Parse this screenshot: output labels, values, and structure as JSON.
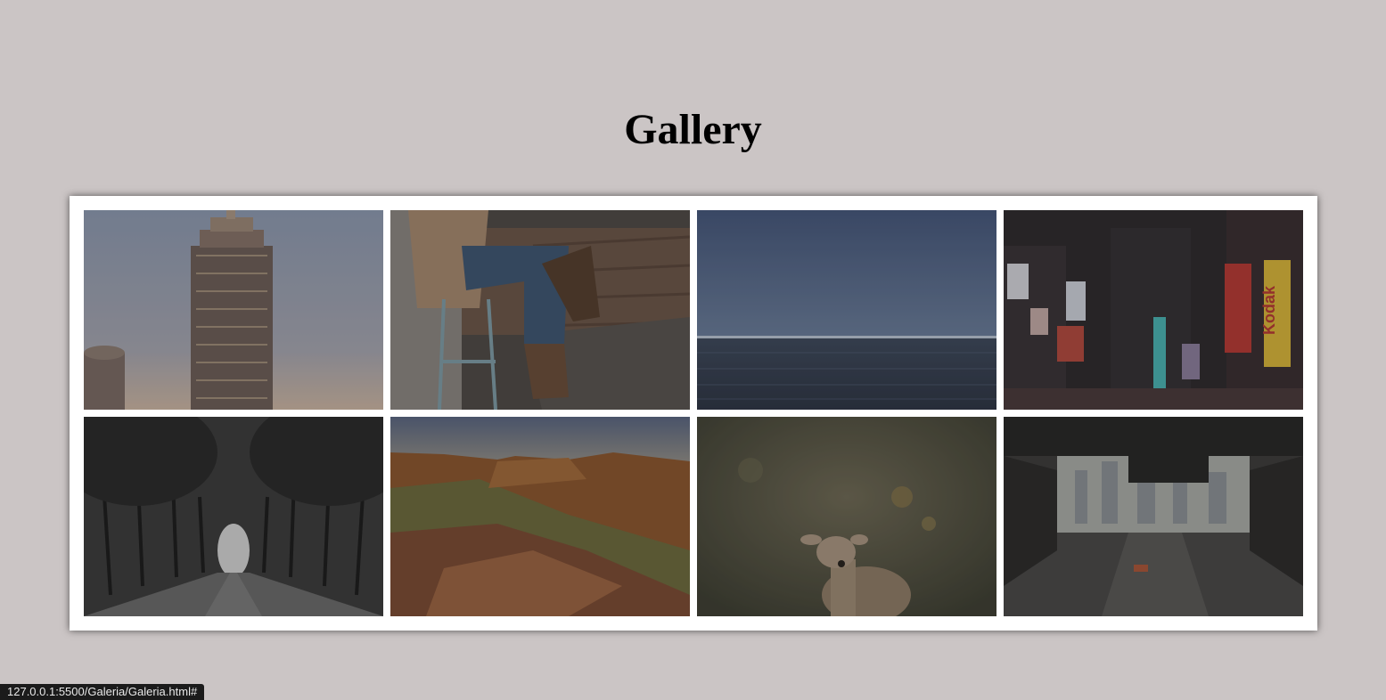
{
  "page": {
    "title": "Gallery"
  },
  "gallery": {
    "images": [
      {
        "name": "skyscraper"
      },
      {
        "name": "person-on-stool"
      },
      {
        "name": "ocean-horizon"
      },
      {
        "name": "times-square-kodak",
        "sign_text": "Kodak"
      },
      {
        "name": "tree-lined-road"
      },
      {
        "name": "red-rock-canyon"
      },
      {
        "name": "fawn-in-forest"
      },
      {
        "name": "city-underpass"
      }
    ]
  },
  "status_bar": {
    "url": "127.0.0.1:5500/Galeria/Galeria.html#"
  }
}
